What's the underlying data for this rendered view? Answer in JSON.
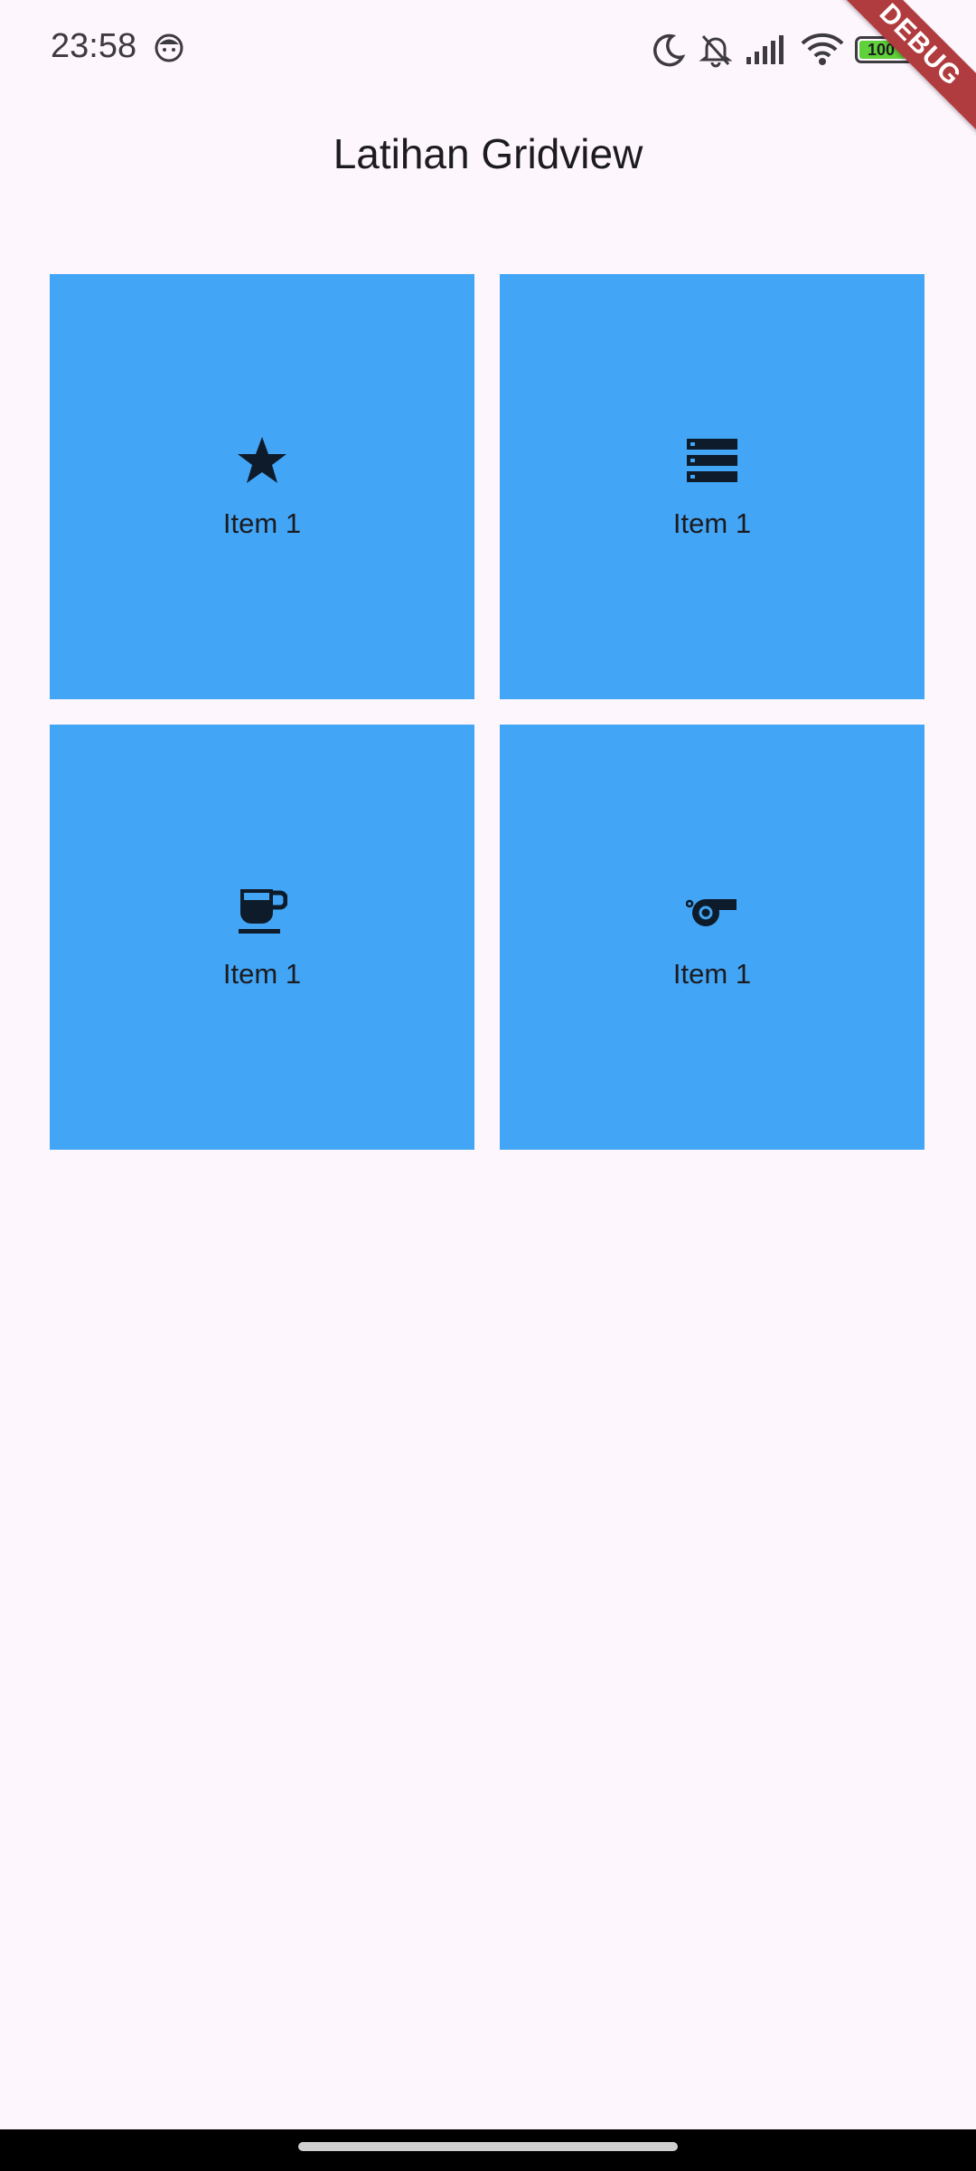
{
  "status_bar": {
    "time": "23:58",
    "battery_level": "100",
    "icons": [
      "face-icon",
      "moon-icon",
      "bell-off-icon",
      "signal-icon",
      "wifi-icon",
      "battery-icon",
      "charging-icon"
    ]
  },
  "debug_banner": "DEBUG",
  "app_bar": {
    "title": "Latihan Gridview"
  },
  "grid": {
    "items": [
      {
        "label": "Item 1",
        "icon": "star-icon"
      },
      {
        "label": "Item 1",
        "icon": "storage-icon"
      },
      {
        "label": "Item 1",
        "icon": "coffee-cup-icon"
      },
      {
        "label": "Item 1",
        "icon": "whistle-icon"
      }
    ]
  },
  "colors": {
    "background": "#fdf6fd",
    "tile": "#42a5f5",
    "icon": "#0d1b2a",
    "debug_banner": "#b13c3f"
  }
}
